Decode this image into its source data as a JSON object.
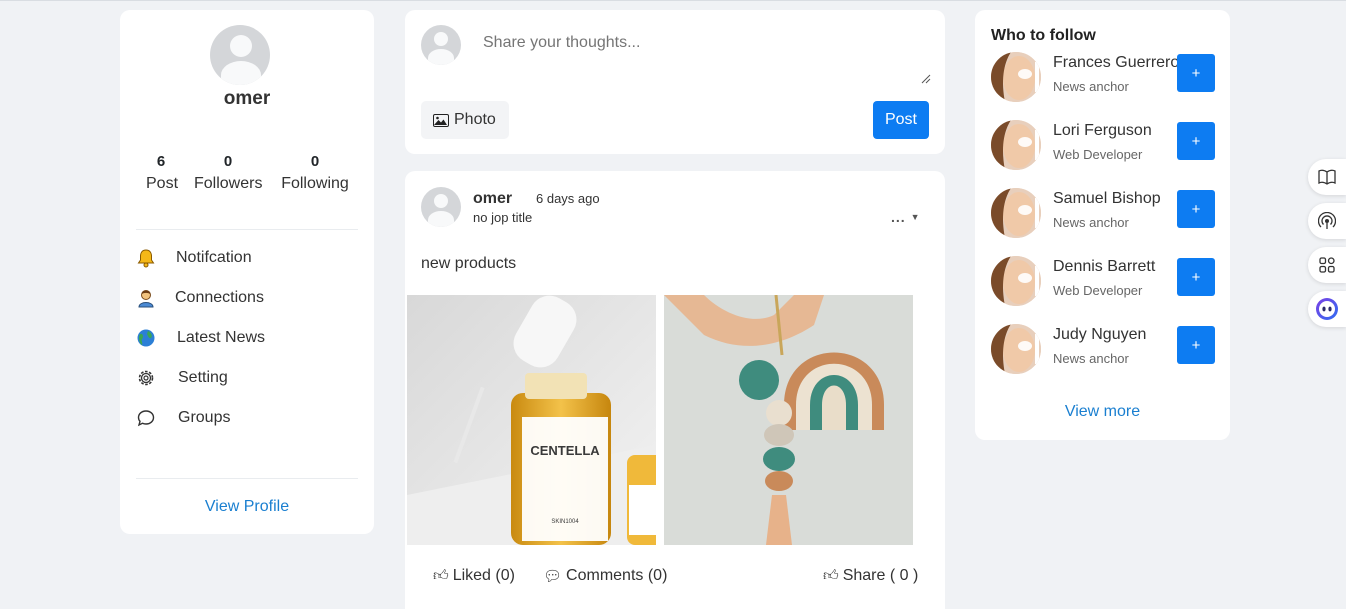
{
  "profile": {
    "name": "omer",
    "stats": [
      {
        "value": "6",
        "label": "Post"
      },
      {
        "value": "0",
        "label": "Followers"
      },
      {
        "value": "0",
        "label": "Following"
      }
    ],
    "nav": [
      {
        "label": "Notifcation",
        "icon": "bell-icon"
      },
      {
        "label": "Connections",
        "icon": "user-icon"
      },
      {
        "label": "Latest News",
        "icon": "globe-icon"
      },
      {
        "label": "Setting",
        "icon": "gear-icon"
      },
      {
        "label": "Groups",
        "icon": "chat-bubble-icon"
      }
    ],
    "view_profile": "View Profile"
  },
  "composer": {
    "placeholder": "Share your thoughts...",
    "photo_label": "Photo",
    "post_label": "Post"
  },
  "post": {
    "author": "omer",
    "time": "6 days ago",
    "subtitle": "no jop title",
    "menu": "...",
    "text": "new products",
    "images": [
      "serum bottle product photo",
      "clay rainbow keychain photo"
    ],
    "liked": "Liked (0)",
    "comments": "Comments (0)",
    "share": "Share ( 0 )"
  },
  "follow": {
    "title": "Who to follow",
    "people": [
      {
        "name": "Frances Guerrero",
        "role": "News anchor"
      },
      {
        "name": "Lori Ferguson",
        "role": "Web Developer"
      },
      {
        "name": "Samuel Bishop",
        "role": "News anchor"
      },
      {
        "name": "Dennis Barrett",
        "role": "Web Developer"
      },
      {
        "name": "Judy Nguyen",
        "role": "News anchor"
      }
    ],
    "add_label": "+",
    "view_more": "View more"
  },
  "sidebar_tools": [
    "book-icon",
    "broadcast-icon",
    "apps-grid-icon",
    "assistant-icon"
  ],
  "colors": {
    "accent": "#0d7cf2",
    "link": "#1a7fd0",
    "background": "#f0f2f5"
  }
}
